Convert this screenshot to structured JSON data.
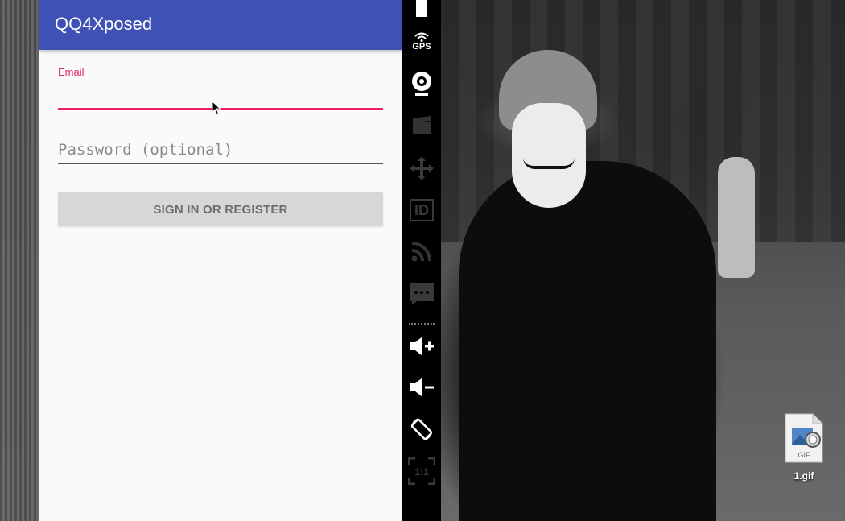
{
  "app": {
    "title": "QQ4Xposed",
    "colors": {
      "app_bar": "#3f51b5",
      "accent": "#e91e63",
      "background": "#fafafa"
    },
    "form": {
      "email_label": "Email",
      "email_value": "",
      "password_placeholder": "Password (optional)",
      "password_value": "",
      "submit_label": "SIGN IN OR REGISTER"
    }
  },
  "emulator_toolbar": {
    "buttons": [
      {
        "icon": "battery-icon"
      },
      {
        "icon": "gps-icon",
        "label": "GPS"
      },
      {
        "icon": "webcam-icon"
      },
      {
        "icon": "screencast-icon"
      },
      {
        "icon": "dpad-move-icon"
      },
      {
        "icon": "device-id-icon",
        "label": "ID"
      },
      {
        "icon": "rss-network-icon"
      },
      {
        "icon": "sms-icon"
      },
      {
        "icon": "volume-up-icon"
      },
      {
        "icon": "volume-down-icon"
      },
      {
        "icon": "rotate-icon"
      },
      {
        "icon": "pixel-perfect-icon",
        "label": "1:1"
      }
    ]
  },
  "desktop": {
    "file": {
      "icon": "gif-file-icon",
      "badge": "GIF",
      "name": "1.gif"
    }
  }
}
